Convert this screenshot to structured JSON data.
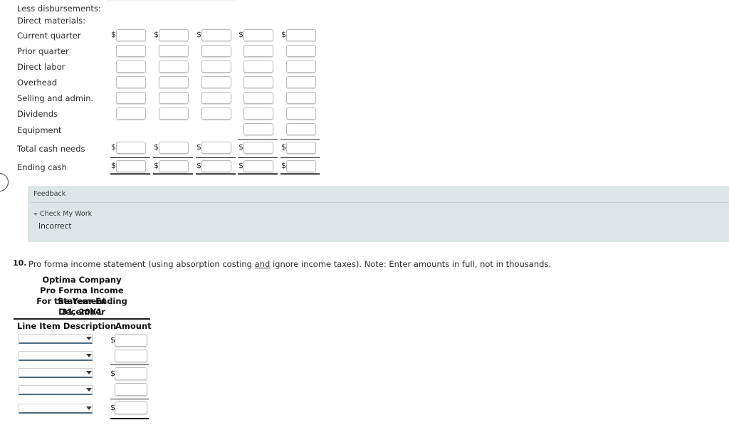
{
  "cash_budget": {
    "section_headers": [
      "Less disbursements:",
      "Direct materials:"
    ],
    "rows": [
      {
        "label": "Current quarter",
        "has_dollar": true,
        "cols": 5
      },
      {
        "label": "Prior quarter",
        "has_dollar": false,
        "cols": 5
      },
      {
        "label": "Direct labor",
        "has_dollar": false,
        "cols": 5
      },
      {
        "label": "Overhead",
        "has_dollar": false,
        "cols": 5
      },
      {
        "label": "Selling and admin.",
        "has_dollar": false,
        "cols": 5
      },
      {
        "label": "Dividends",
        "has_dollar": false,
        "cols": 5
      },
      {
        "label": "Equipment",
        "has_dollar": false,
        "cols": 2
      },
      {
        "label": "Total cash needs",
        "has_dollar": true,
        "cols": 5
      },
      {
        "label": "Ending cash",
        "has_dollar": true,
        "cols": 5
      }
    ],
    "dollar_sign": "$",
    "input_value": "",
    "input_placeholder": ""
  },
  "feedback": {
    "title": "Feedback",
    "check_my_work_label": "Check My Work",
    "result": "Incorrect",
    "background_color": "#dde5e7",
    "toggle_icon": "caret-down-icon"
  },
  "question": {
    "number": "10.",
    "text_before": "Pro forma income statement (using absorption costing ",
    "underlined": "and",
    "text_after": " ignore income taxes). Note: Enter amounts in full, not in thousands."
  },
  "statement": {
    "title_lines": [
      "Optima Company",
      "Pro Forma Income Statement",
      "For the Year Ending December",
      "31, 20X1"
    ],
    "columns": [
      "Line Item Description",
      "Amount"
    ],
    "rows": [
      {
        "description_value": "",
        "has_dollar": true,
        "amount_value": ""
      },
      {
        "description_value": "",
        "has_dollar": false,
        "amount_value": ""
      },
      {
        "description_value": "",
        "has_dollar": true,
        "amount_value": ""
      },
      {
        "description_value": "",
        "has_dollar": false,
        "amount_value": ""
      },
      {
        "description_value": "",
        "has_dollar": true,
        "amount_value": ""
      }
    ],
    "dropdown_options": [
      ""
    ],
    "dollar_sign": "$",
    "dropdown_accent_color": "#4a6b84"
  }
}
